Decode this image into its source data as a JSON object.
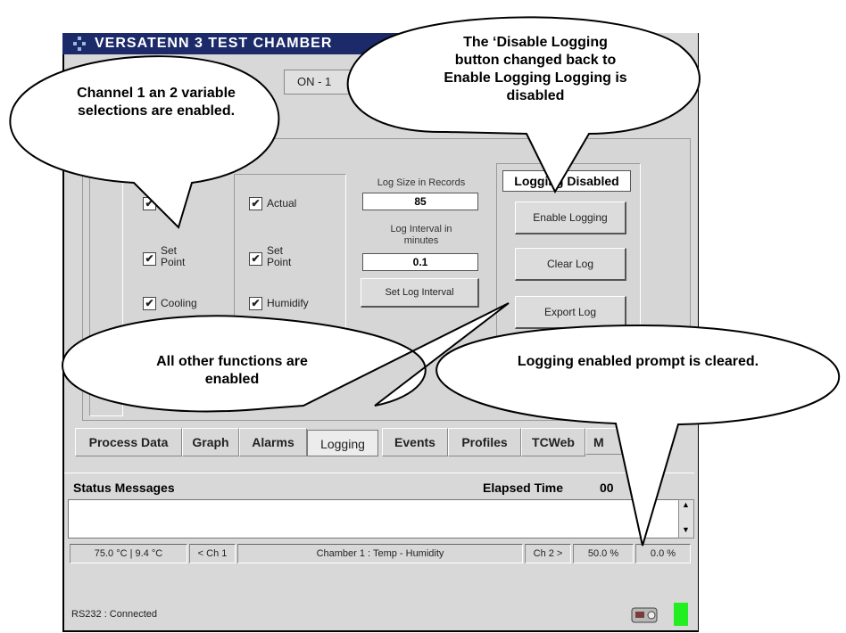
{
  "window": {
    "title": "VERSATENN 3 TEST CHAMBER",
    "on_button": "ON - 1"
  },
  "ch1": {
    "items": [
      {
        "label": "Set Point"
      },
      {
        "label": "Cooling"
      }
    ]
  },
  "ch2": {
    "items": [
      {
        "label": "Actual"
      },
      {
        "label": "Set Point"
      },
      {
        "label": "Humidify"
      }
    ]
  },
  "log": {
    "size_label": "Log Size in Records",
    "size_value": "85",
    "interval_label": "Log Interval in minutes",
    "interval_value": "0.1",
    "set_interval_button": "Set Log Interval",
    "status": "Logging Disabled",
    "enable_button": "Enable Logging",
    "clear_button": "Clear Log",
    "export_button": "Export Log"
  },
  "tabs": [
    "Process Data",
    "Graph",
    "Alarms",
    "Logging",
    "Events",
    "Profiles",
    "TCWeb",
    "M"
  ],
  "status": {
    "header": "Status Messages",
    "elapsed_label": "Elapsed Time",
    "elapsed_value": "00"
  },
  "statusbar": {
    "temps": "75.0 °C  |  9.4 °C",
    "ch1_button": "< Ch 1",
    "chamber": "Chamber 1 : Temp - Humidity",
    "ch2_button": "Ch 2 >",
    "pct1": "50.0 %",
    "pct2": "0.0 %"
  },
  "connection": "RS232 : Connected",
  "callouts": {
    "c1": "Channel 1 an 2 variable selections are enabled.",
    "c2": "The ‘Disable Logging button changed back to Enable Logging Logging is disabled",
    "c3": "All other functions are enabled",
    "c4": "Logging enabled prompt is cleared."
  },
  "colors": {
    "titlebar": "#1c2a6a",
    "led": "#22ee22"
  }
}
